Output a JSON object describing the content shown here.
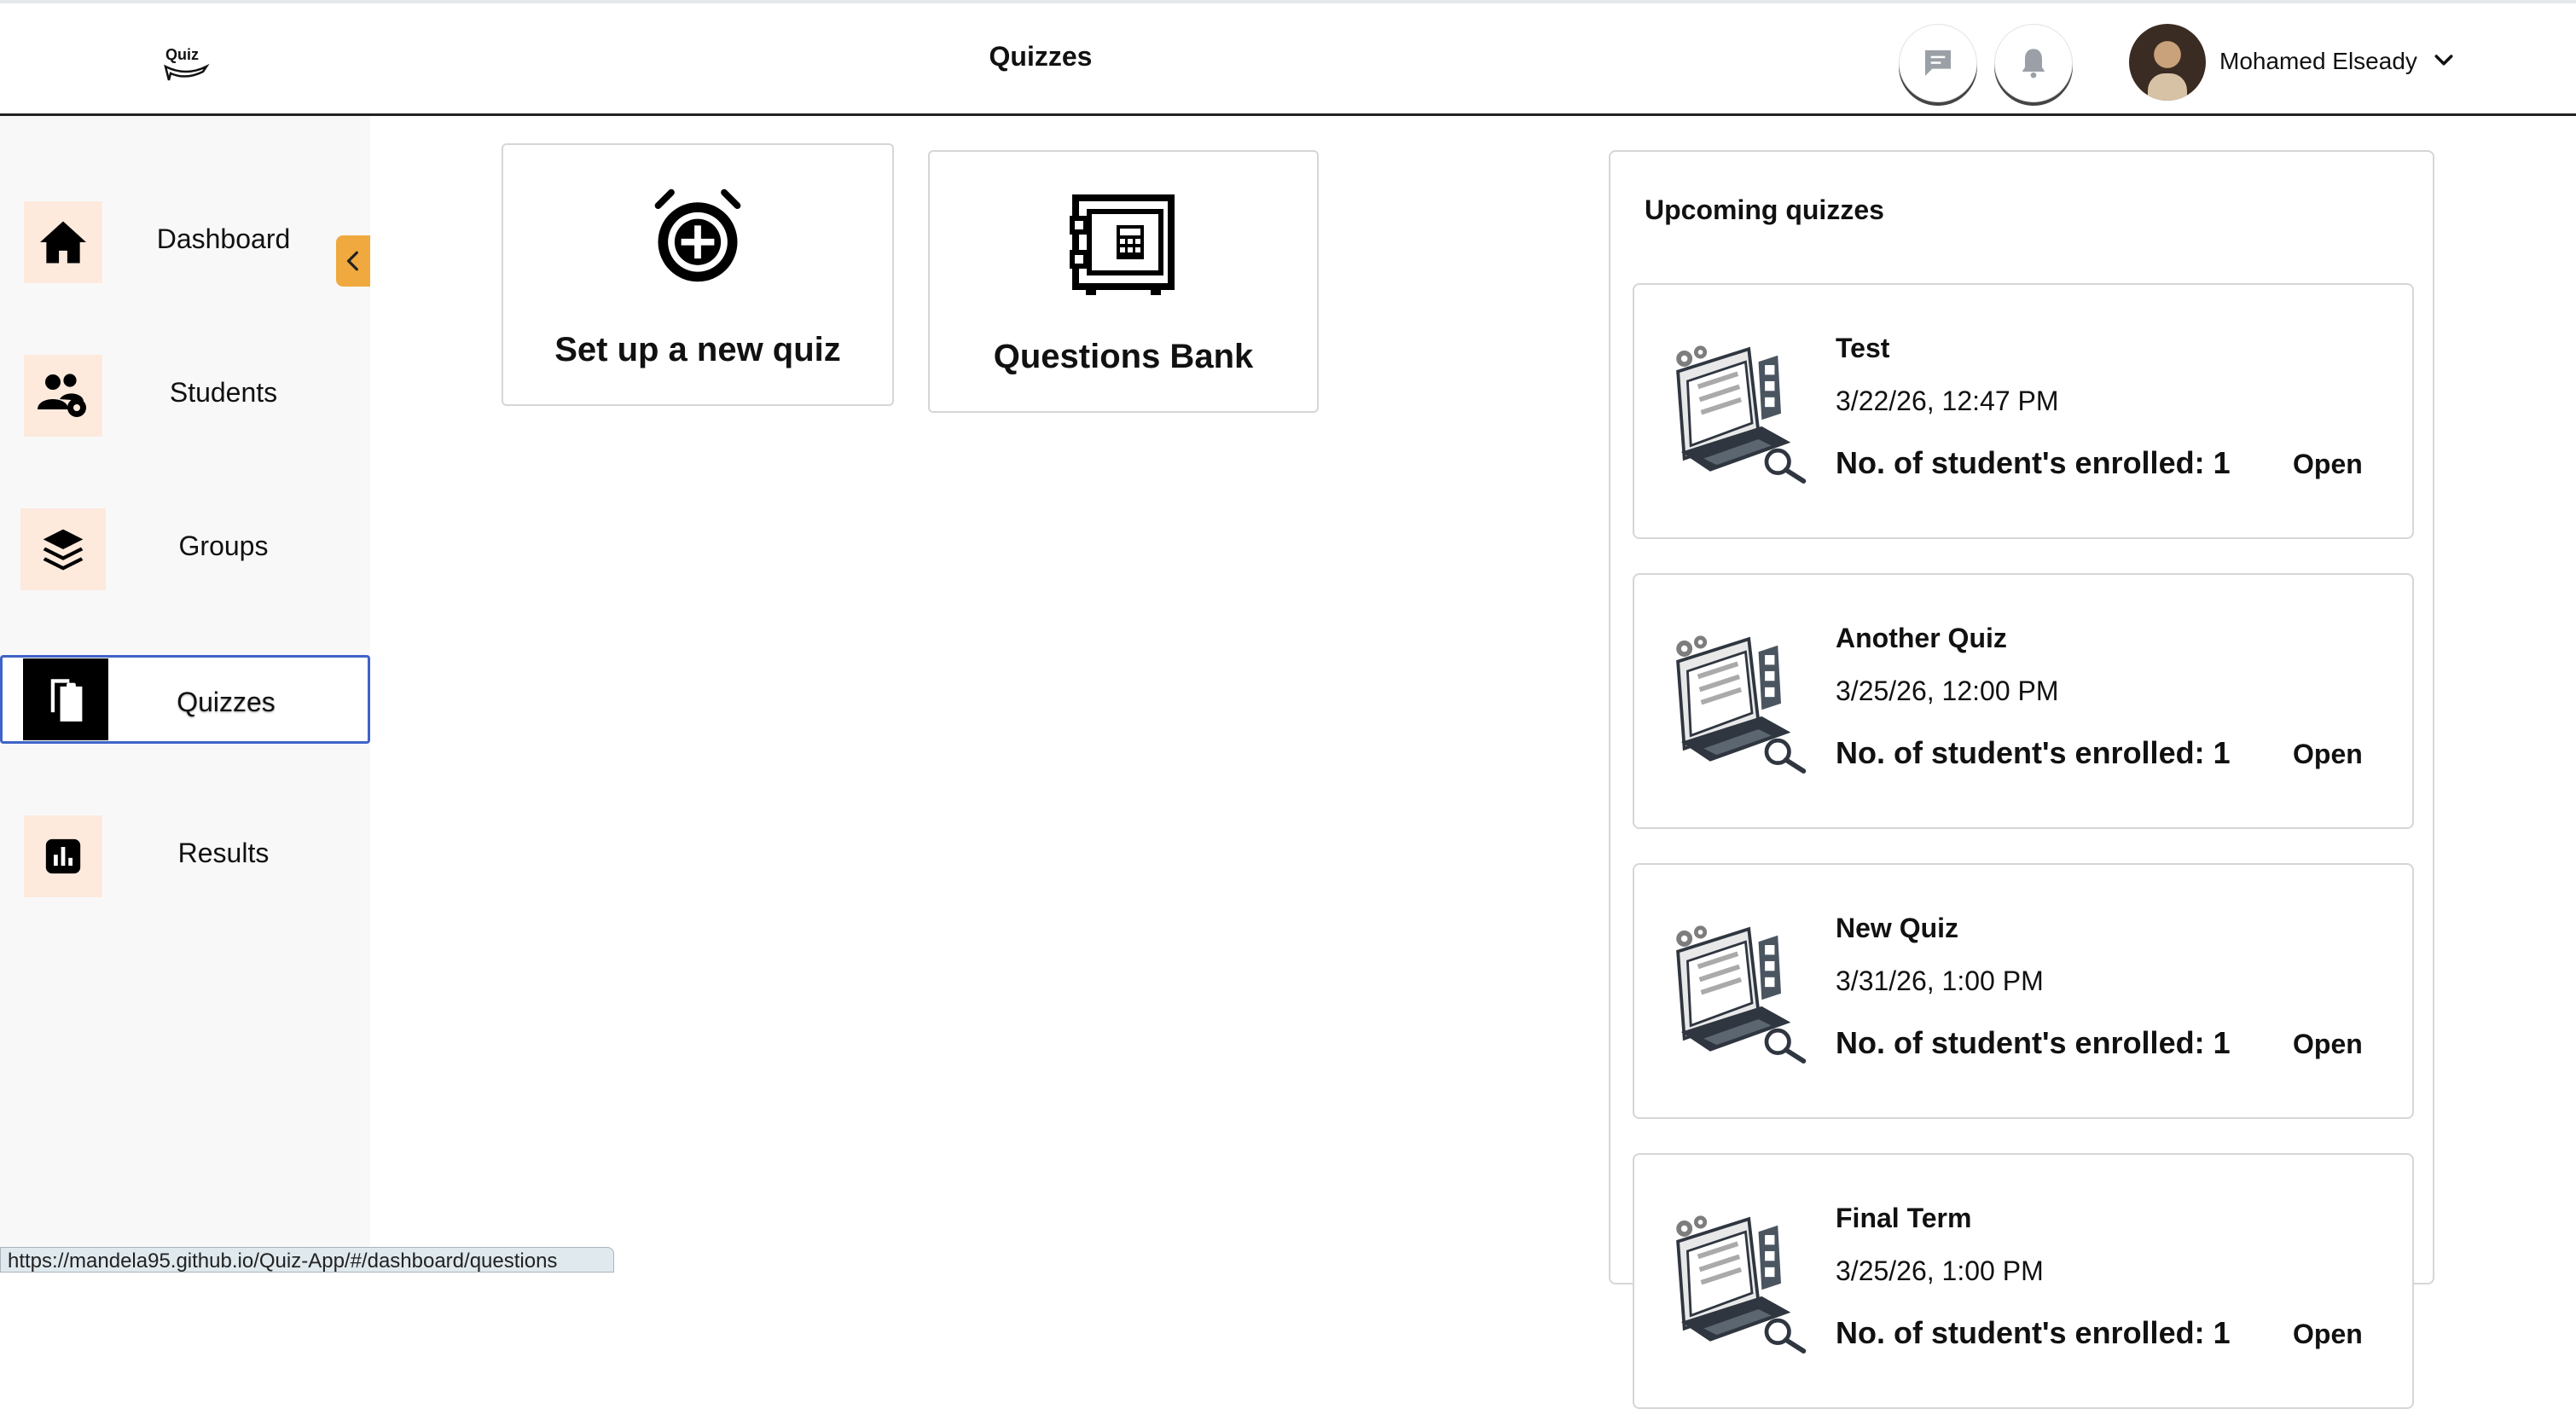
{
  "header": {
    "logo_text": "Quiz",
    "title": "Quizzes",
    "user_name": "Mohamed Elseady",
    "icons": [
      "message-icon",
      "bell-icon",
      "chevron-down-icon"
    ]
  },
  "sidebar": {
    "items": [
      {
        "label": "Dashboard",
        "icon": "home-icon"
      },
      {
        "label": "Students",
        "icon": "students-icon"
      },
      {
        "label": "Groups",
        "icon": "layers-icon"
      },
      {
        "label": "Quizzes",
        "icon": "clipboard-icon",
        "active": true
      },
      {
        "label": "Results",
        "icon": "chart-icon"
      }
    ],
    "active_color": "#000000",
    "icon_bg_color": "#fdeadd",
    "collapse_button_color": "#f0a93f"
  },
  "actions": {
    "new_quiz_label": "Set up a new quiz",
    "bank_label": "Questions Bank"
  },
  "upcoming": {
    "title": "Upcoming quizzes",
    "quizzes": [
      {
        "title": "Test",
        "date": "3/22/26, 12:47 PM",
        "enrolled": "No. of student's enrolled: 1",
        "action": "Open"
      },
      {
        "title": "Another Quiz",
        "date": "3/25/26, 12:00 PM",
        "enrolled": "No. of student's enrolled: 1",
        "action": "Open"
      },
      {
        "title": "New Quiz",
        "date": "3/31/26, 1:00 PM",
        "enrolled": "No. of student's enrolled: 1",
        "action": "Open"
      },
      {
        "title": "Final Term",
        "date": "3/25/26, 1:00 PM",
        "enrolled": "No. of student's enrolled: 1",
        "action": "Open"
      }
    ]
  },
  "status_bar": {
    "url": "https://mandela95.github.io/Quiz-App/#/dashboard/questions"
  }
}
